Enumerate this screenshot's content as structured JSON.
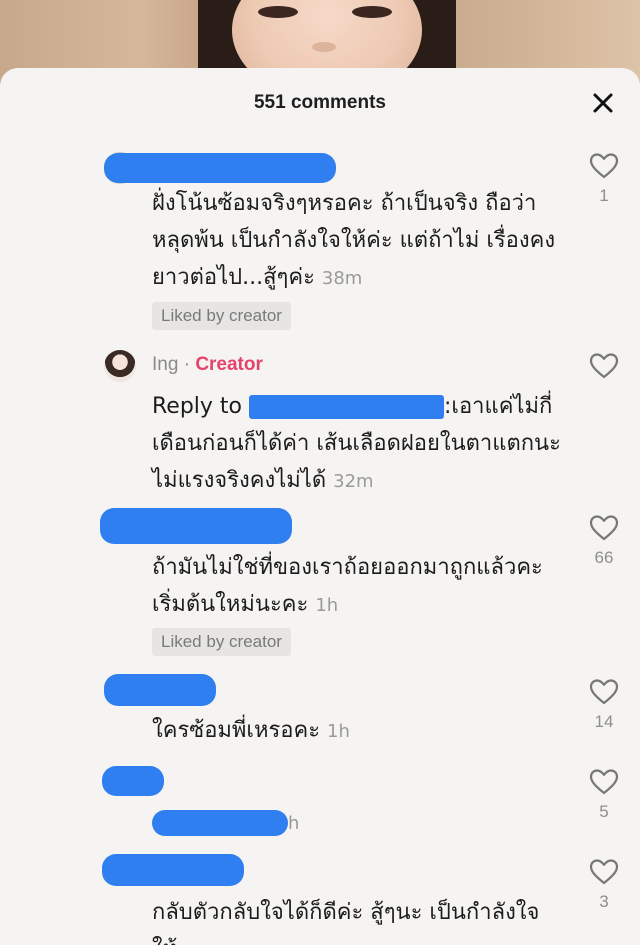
{
  "header": {
    "comment_count": "551 comments"
  },
  "comments": [
    {
      "text": "ฝั่งโน้นซ้อมจริงๆหรอคะ ถ้าเป็นจริง ถือว่าหลุดพ้น เป็นกำลังใจให้ค่ะ แต่ถ้าไม่ เรื่องคงยาวต่อไป...สู้ๆค่ะ",
      "time": "38m",
      "liked_by_creator": "Liked by creator",
      "likes": "1"
    },
    {
      "username": "Ing",
      "separator": "·",
      "creator_label": "Creator",
      "reply_prefix": "Reply to",
      "text": ":เอาแค่ไม่กี่เดือนก่อนก็ได้ค่า เส้นเลือดฝอยในตาแตกนะ ไม่แรงจริงคงไม่ได้",
      "time": "32m"
    },
    {
      "text": "ถ้ามันไม่ใช่ที่ของเราถ้อยออกมาถูกแล้วคะ เริ่มต้นใหม่นะคะ",
      "time": "1h",
      "liked_by_creator": "Liked by creator",
      "likes": "66"
    },
    {
      "text": "ใครซ้อมพี่เหรอคะ",
      "time": "1h",
      "likes": "14"
    },
    {
      "text": "h",
      "likes": "5"
    },
    {
      "text": "กลับตัวกลับใจได้ก็ดีค่ะ สู้ๆนะ เป็นกำลังใจให้",
      "likes": "3"
    }
  ],
  "icons": {
    "close": "close-icon",
    "like": "heart-outline-icon"
  },
  "colors": {
    "redaction": "#2f7ff0",
    "creator": "#e5446a"
  }
}
